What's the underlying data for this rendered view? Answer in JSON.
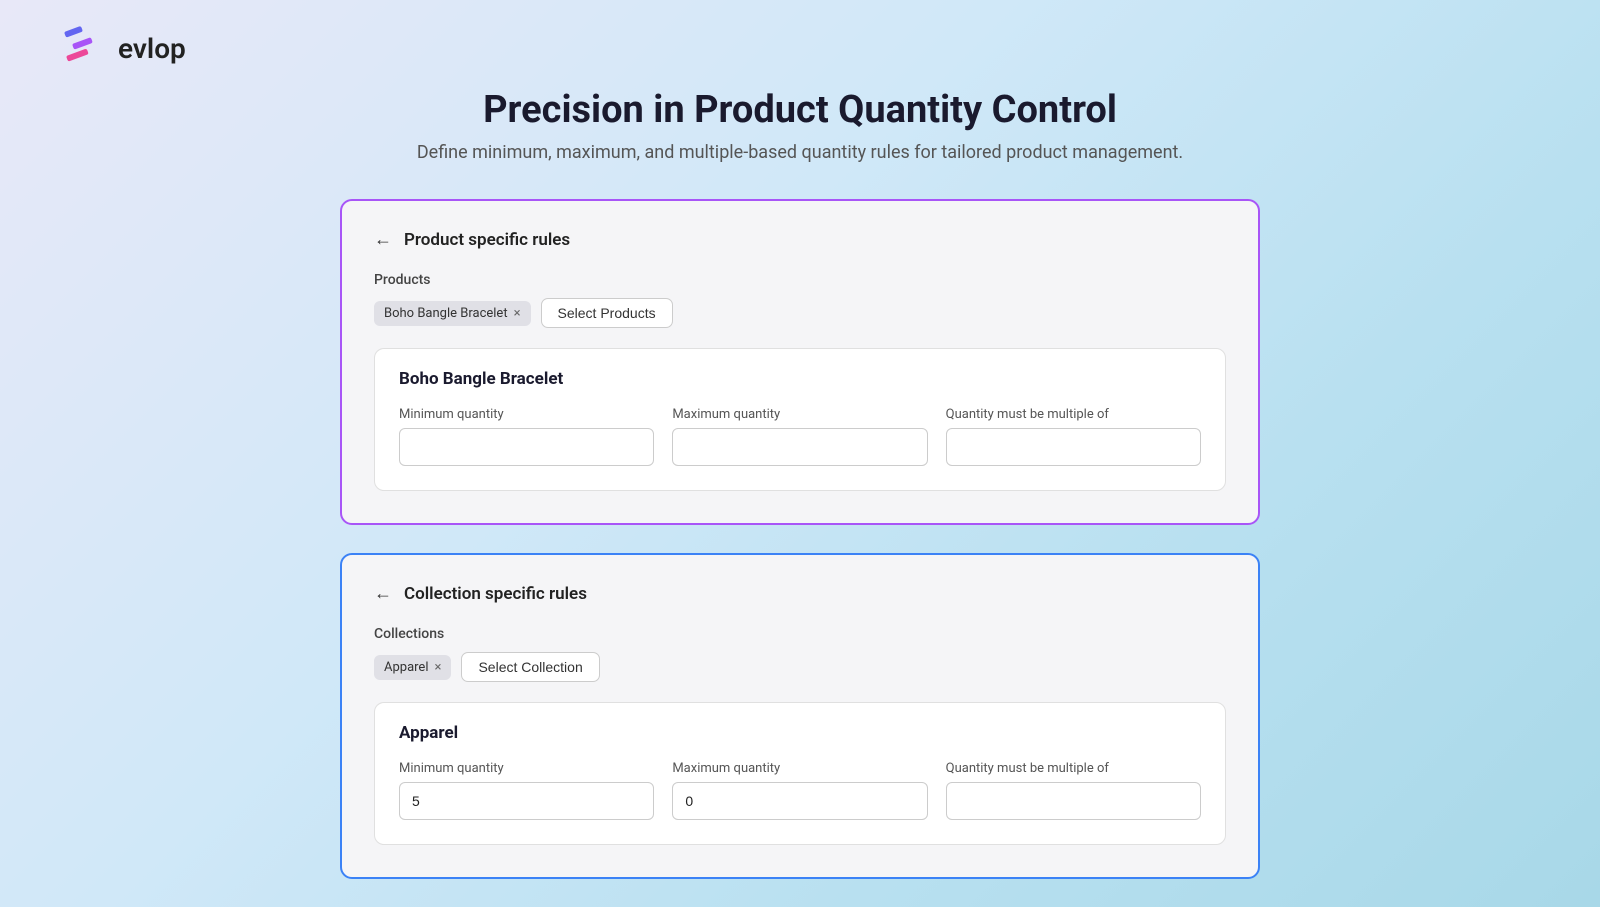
{
  "logo": {
    "text": "evlop"
  },
  "header": {
    "title": "Precision in Product Quantity Control",
    "subtitle": "Define minimum, maximum, and multiple-based quantity rules for tailored product management."
  },
  "product_card": {
    "back_label": "←",
    "title": "Product specific rules",
    "section_label": "Products",
    "tag_label": "Boho Bangle Bracelet",
    "tag_close": "×",
    "select_button": "Select Products",
    "product_name": "Boho Bangle Bracelet",
    "fields": {
      "min_label": "Minimum quantity",
      "min_value": "",
      "max_label": "Maximum quantity",
      "max_value": "",
      "multiple_label": "Quantity must be multiple of",
      "multiple_value": ""
    }
  },
  "collection_card": {
    "back_label": "←",
    "title": "Collection specific rules",
    "section_label": "Collections",
    "tag_label": "Apparel",
    "tag_close": "×",
    "select_button": "Select Collection",
    "collection_name": "Apparel",
    "fields": {
      "min_label": "Minimum quantity",
      "min_value": "5",
      "max_label": "Maximum quantity",
      "max_value": "0",
      "multiple_label": "Quantity must be multiple of",
      "multiple_value": ""
    }
  }
}
